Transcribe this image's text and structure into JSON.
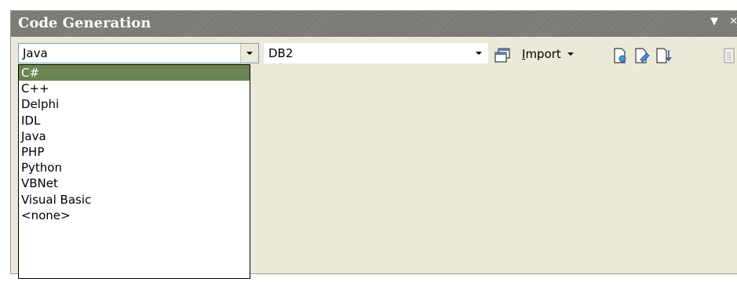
{
  "panel": {
    "title": "Code Generation",
    "controls": {
      "menu_icon": "dropdown-triangle",
      "close_icon": "close-x"
    }
  },
  "toolbar": {
    "language_select": {
      "value": "Java"
    },
    "database_select": {
      "value": "DB2"
    },
    "import_button": {
      "label": "Import",
      "mnemonic": "I"
    },
    "icons": [
      "window-icon",
      "new-document-icon",
      "edit-document-icon",
      "document-down-icon",
      "document-disabled-icon"
    ]
  },
  "language_dropdown": {
    "selected_index": 0,
    "options": [
      "C#",
      "C++",
      "Delphi",
      "IDL",
      "Java",
      "PHP",
      "Python",
      "VBNet",
      "Visual Basic",
      "<none>"
    ]
  },
  "colors": {
    "titlebar": "#7a7873",
    "panel_bg": "#ece9d8",
    "selection": "#6b8453",
    "combo_border": "#7f9db9"
  }
}
